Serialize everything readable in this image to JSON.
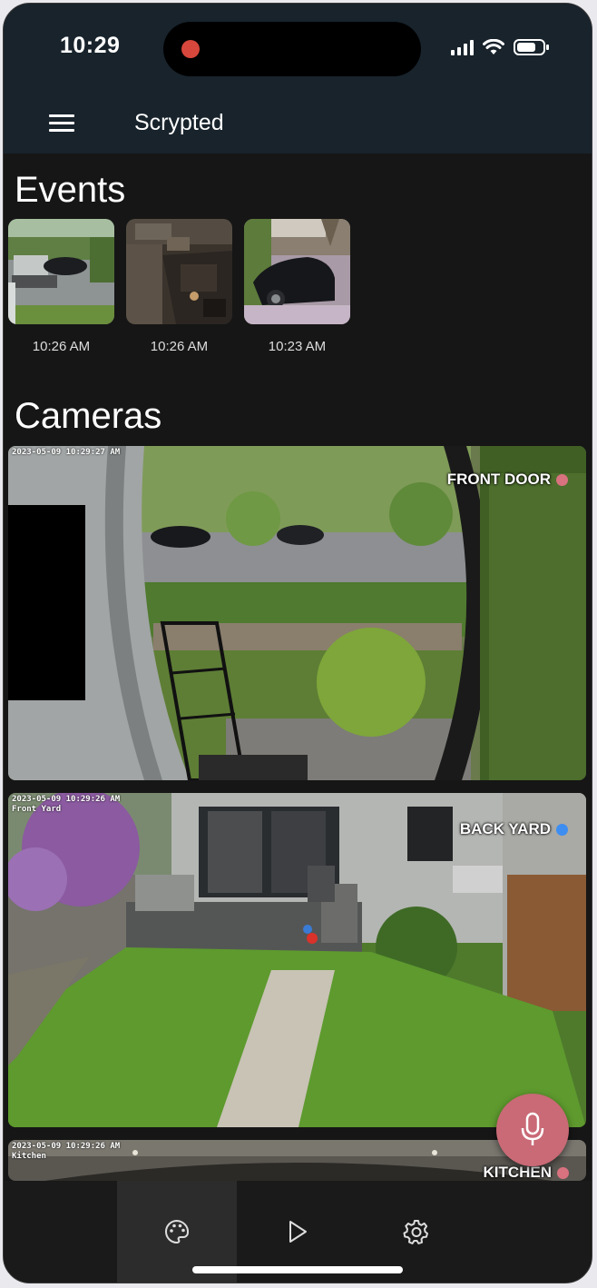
{
  "status_bar": {
    "time": "10:29"
  },
  "header": {
    "title": "Scrypted"
  },
  "events": {
    "heading": "Events",
    "items": [
      {
        "time": "10:26 AM"
      },
      {
        "time": "10:26 AM"
      },
      {
        "time": "10:23 AM"
      }
    ]
  },
  "cameras": {
    "heading": "Cameras",
    "items": [
      {
        "name": "FRONT DOOR",
        "status_color": "#d9727f",
        "osd": "2023-05-09 10:29:27 AM"
      },
      {
        "name": "BACK YARD",
        "status_color": "#3d8ef0",
        "osd": "2023-05-09 10:29:26 AM",
        "osd_sub": "Front Yard"
      },
      {
        "name": "KITCHEN",
        "status_color": "#d9727f",
        "osd": "2023-05-09 10:29:26 AM",
        "osd_sub": "Kitchen"
      }
    ]
  },
  "nav": {
    "items": [
      {
        "icon": "palette-icon",
        "active": true
      },
      {
        "icon": "play-icon",
        "active": false
      },
      {
        "icon": "gear-icon",
        "active": false
      }
    ]
  },
  "fab": {
    "icon": "microphone-icon",
    "color": "#c96a76"
  }
}
